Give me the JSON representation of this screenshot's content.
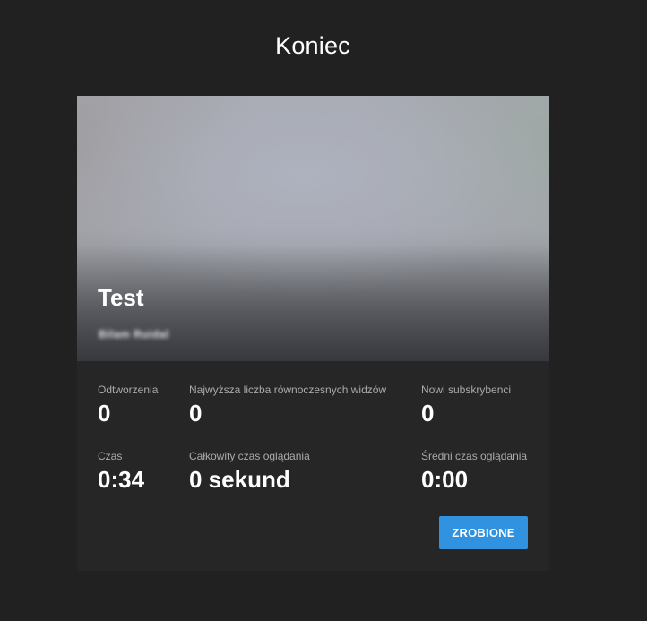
{
  "dialog": {
    "title": "Koniec"
  },
  "video": {
    "title": "Test",
    "channel": "Bilam Ruidal"
  },
  "stats": {
    "playbacks": {
      "label": "Odtworzenia",
      "value": "0"
    },
    "peak_concurrent": {
      "label": "Najwyższa liczba równoczesnych widzów",
      "value": "0"
    },
    "new_subscribers": {
      "label": "Nowi subskrybenci",
      "value": "0"
    },
    "duration": {
      "label": "Czas",
      "value": "0:34"
    },
    "total_watch_time": {
      "label": "Całkowity czas oglądania",
      "value": "0 sekund"
    },
    "avg_watch_time": {
      "label": "Średni czas oglądania",
      "value": "0:00"
    }
  },
  "actions": {
    "done_label": "ZROBIONE"
  },
  "colors": {
    "background": "#212121",
    "card": "#262626",
    "accent": "#3193e0"
  }
}
